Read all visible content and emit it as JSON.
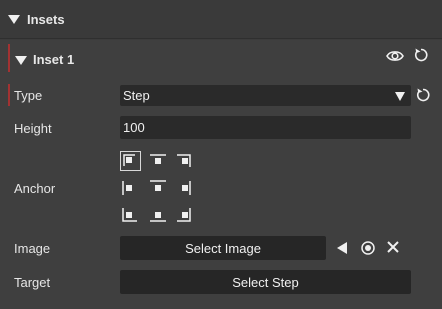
{
  "section": {
    "title": "Insets"
  },
  "inset": {
    "title": "Inset 1"
  },
  "fields": {
    "type_label": "Type",
    "type_value": "Step",
    "height_label": "Height",
    "height_value": "100",
    "anchor_label": "Anchor",
    "image_label": "Image",
    "image_button": "Select Image",
    "target_label": "Target",
    "target_button": "Select Step"
  },
  "anchor": {
    "selected": "top-left"
  },
  "icons": {
    "visibility": "eye-icon",
    "reset": "reset-icon",
    "dropdown": "chevron-down-icon",
    "prev": "play-back-icon",
    "center": "target-dot-icon",
    "clear": "close-icon"
  },
  "colors": {
    "accent_bar": "#a33232",
    "background": "#3c3c3c",
    "field": "#2a2a2a"
  }
}
